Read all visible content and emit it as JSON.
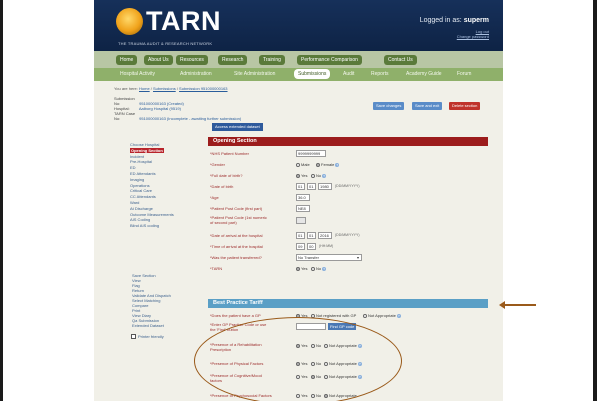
{
  "header": {
    "logo_text": "TARN",
    "logo_subtitle": "THE TRAUMA AUDIT & RESEARCH NETWORK",
    "logged_in_label": "Logged in as:",
    "username": "superm",
    "logout": "Log out",
    "change_password": "Change password"
  },
  "nav_primary": [
    "Home",
    "About Us",
    "Resources",
    "Research",
    "Training",
    "Performance Comparison",
    "Contact Us"
  ],
  "nav_secondary": [
    "Hospital Activity",
    "Administration",
    "Site Administration",
    "Submissions",
    "Audit",
    "Reports",
    "Academy Guide",
    "Forum"
  ],
  "breadcrumb": {
    "prefix": "You are here:",
    "home": "Home",
    "submissions": "Submissions",
    "current": "Submission 951000000163"
  },
  "submission": {
    "no_label": "Submission No:",
    "no_value": "951000000163 (Created)",
    "hospital_label": "Hospital:",
    "hospital_value": "Aalborg Hospital (9519)",
    "case_label": "TARN Case No:",
    "case_value": "951000000163 (Incomplete - awaiting further submission)"
  },
  "actions": {
    "save_changes": "Save changes",
    "save_exit": "Save and exit",
    "delete": "Delete section",
    "extended": "Access extended dataset"
  },
  "sidebar": {
    "sections": [
      "Choose Hospital",
      "Opening Section",
      "Incident",
      "Pre-Hospital",
      "ED",
      "ED Attendants",
      "Imaging",
      "Operations",
      "Critical Care",
      "CC Attendants",
      "Ward",
      "At Discharge",
      "Outcome Measurements",
      "AIS Coding",
      "Blind AIS coding"
    ],
    "tools": [
      "Save Section",
      "View",
      "Flag",
      "Return",
      "Validate And Dispatch",
      "Select Matching",
      "Compare",
      "Print",
      "View Diary",
      "Qa Submission",
      "Extended Dataset"
    ],
    "printer": "Printer friendly"
  },
  "opening": {
    "title": "Opening Section",
    "nhs_label": "*NHS Patient Number",
    "nhs_value": "9999999999",
    "gender_label": "*Gender",
    "gender_male": "Male",
    "gender_female": "Female",
    "dob_known_label": "*Full date of birth?",
    "yes": "Yes",
    "no": "No",
    "dob_label": "*Date of birth",
    "dob_dd": "01",
    "dob_mm": "01",
    "dob_yyyy": "1980",
    "date_hint": "(DD/MM/YYYY)",
    "age_label": "*Age",
    "age_value": "36.0",
    "postcode_label": "*Patient Post Code (first part)",
    "postcode_value": "NE8",
    "postcode2_label": "*Patient Post Code (1st numeric of second part)",
    "arrival_date_label": "*Date of arrival at the hospital",
    "arr_dd": "01",
    "arr_mm": "01",
    "arr_yyyy": "2016",
    "arrival_time_label": "*Time of arrival at the hospital",
    "arr_hh": "09",
    "arr_min": "00",
    "time_hint": "(HH:MM)",
    "transfer_label": "*Was the patient transferred?",
    "transfer_value": "No Transfer",
    "tarn_label": "*TARN"
  },
  "tariff": {
    "title": "Best Practice Tariff",
    "gp_label": "*Does the patient have a GP",
    "gp_registered": "Not registered with GP",
    "not_appropriate": "Not Appropriate",
    "gp_code_label": "*Enter GP Practice Code or use the 'Find' button",
    "find_gp": "Find GP code",
    "rehab_label": "*Presence of a Rehabilitation Prescription",
    "physical_label": "*Presence of Physical Factors",
    "cognitive_label": "*Presence of Cognitive/Mood factors",
    "psychosocial_label": "*Presence of Psychosocial Factors"
  },
  "colors": {
    "header_navy": "#16305a",
    "nav_green": "#8fb06a",
    "section_red": "#9c1c1c",
    "tariff_blue": "#5a9fc6",
    "annotation_brown": "#9a5a1a"
  }
}
